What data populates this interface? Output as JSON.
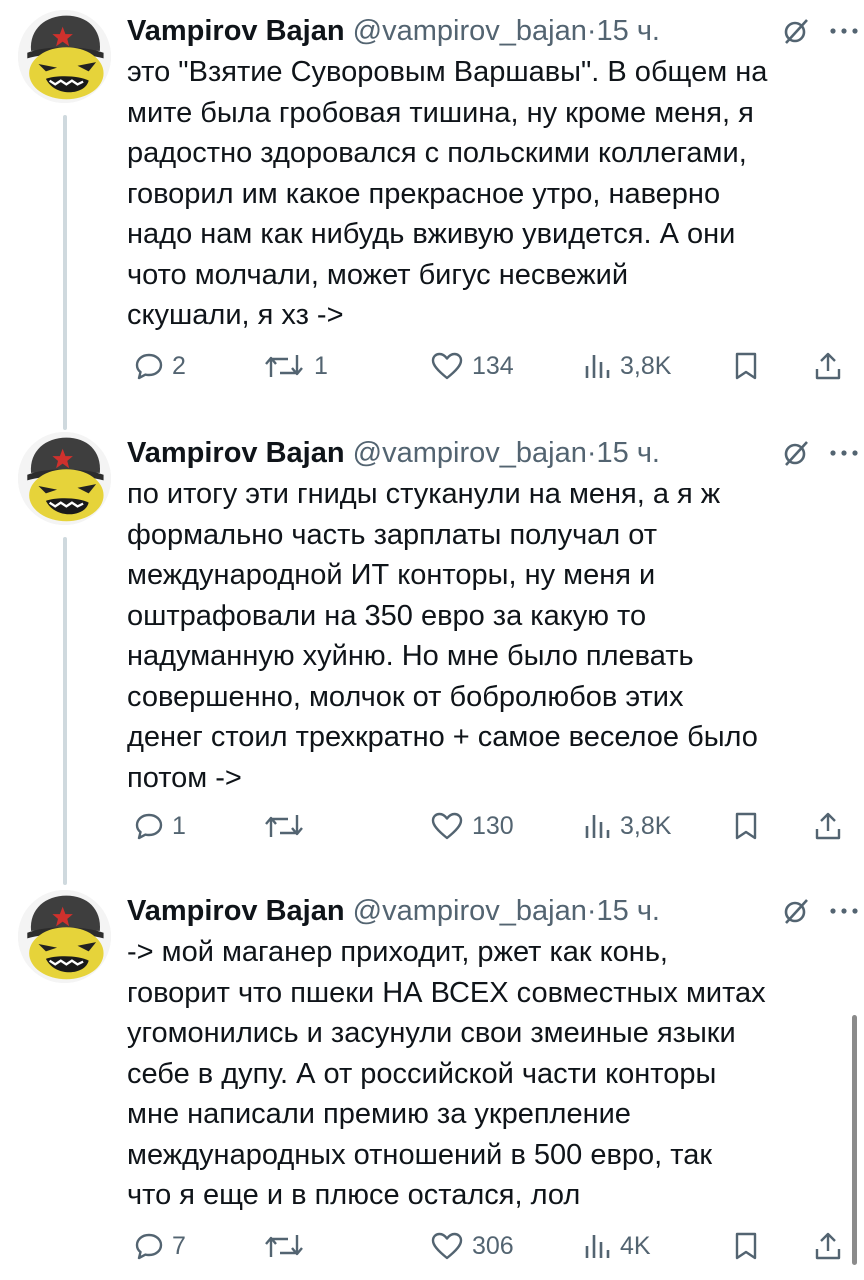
{
  "author": {
    "name": "Vampirov Bajan",
    "handle": "@vampirov_bajan",
    "separator": "·"
  },
  "tweets": [
    {
      "time": "15 ч.",
      "text": "это \"Взятие Суворовым Варшавы\". В общем на\nмите была гробовая тишина, ну кроме меня, я\nрадостно здоровался с польскими коллегами,\nговорил им какое прекрасное утро, наверно\nнадо нам как нибудь вживую увидется. А они\nчото молчали, может бигус несвежий\nскушали, я хз ->",
      "replies": "2",
      "retweets": "1",
      "likes": "134",
      "views": "3,8K"
    },
    {
      "time": "15 ч.",
      "text": "по итогу эти гниды стуканули на меня, а я ж\nформально часть зарплаты получал от\nмеждународной ИТ конторы, ну меня и\nоштрафовали на 350 евро за какую то\nнадуманную хуйню. Но мне было плевать\nсовершенно, молчок от бобролюбов этих\nденег стоил трехкратно + самое веселое было\nпотом ->",
      "replies": "1",
      "retweets": "",
      "likes": "130",
      "views": "3,8K"
    },
    {
      "time": "15 ч.",
      "text": "-> мой маганер приходит, ржет как конь,\nговорит что пшеки НА ВСЕХ совместных митах\nугомонились и засунули свои змеиные языки\nсебе в дупу. А от российской части конторы\nмне написали премию за укрепление\nмеждународных отношений в 500 евро, так\nчто я еще и в плюсе остался, лол",
      "replies": "7",
      "retweets": "",
      "likes": "306",
      "views": "4K"
    }
  ],
  "icons": {
    "reply": "reply-icon",
    "retweet": "retweet-icon",
    "like": "heart-icon",
    "views": "views-icon",
    "bookmark": "bookmark-icon",
    "share": "share-icon",
    "grok": "grok-icon",
    "more": "more-icon"
  },
  "colors": {
    "text": "#0f1419",
    "secondary": "#536471",
    "thread_line": "#cfd9de"
  }
}
